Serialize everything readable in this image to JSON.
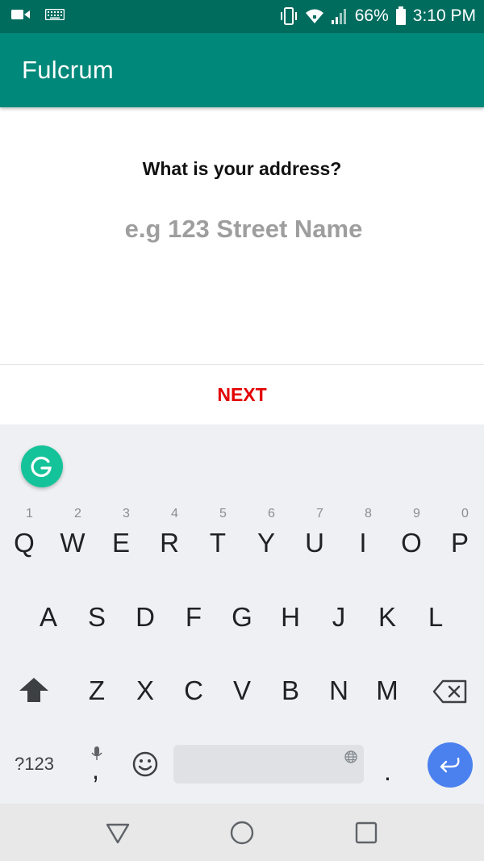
{
  "status_bar": {
    "left_icons": [
      "video-camera-icon",
      "keyboard-icon"
    ],
    "right_icons": [
      "vibrate-icon",
      "wifi-icon",
      "signal-icon",
      "battery-icon"
    ],
    "battery": "66%",
    "time": "3:10 PM"
  },
  "app_bar": {
    "title": "Fulcrum"
  },
  "form": {
    "question": "What is your address?",
    "address_placeholder": "e.g 123 Street Name",
    "address_value": ""
  },
  "actions": {
    "next_label": "NEXT"
  },
  "keyboard": {
    "assistant_icon": "grammarly-icon",
    "row1": [
      {
        "label": "Q",
        "hint": "1"
      },
      {
        "label": "W",
        "hint": "2"
      },
      {
        "label": "E",
        "hint": "3"
      },
      {
        "label": "R",
        "hint": "4"
      },
      {
        "label": "T",
        "hint": "5"
      },
      {
        "label": "Y",
        "hint": "6"
      },
      {
        "label": "U",
        "hint": "7"
      },
      {
        "label": "I",
        "hint": "8"
      },
      {
        "label": "O",
        "hint": "9"
      },
      {
        "label": "P",
        "hint": "0"
      }
    ],
    "row2": [
      "A",
      "S",
      "D",
      "F",
      "G",
      "H",
      "J",
      "K",
      "L"
    ],
    "row3": [
      "Z",
      "X",
      "C",
      "V",
      "B",
      "N",
      "M"
    ],
    "symbols_label": "?123",
    "comma_label": ",",
    "period_label": "."
  },
  "colors": {
    "status_bar": "#006c5e",
    "app_bar": "#00887a",
    "next": "#e20000",
    "grammarly": "#15c39a",
    "enter": "#4b80ef"
  },
  "nav_bar": {
    "buttons": [
      "back-icon",
      "home-icon",
      "recents-icon"
    ]
  }
}
